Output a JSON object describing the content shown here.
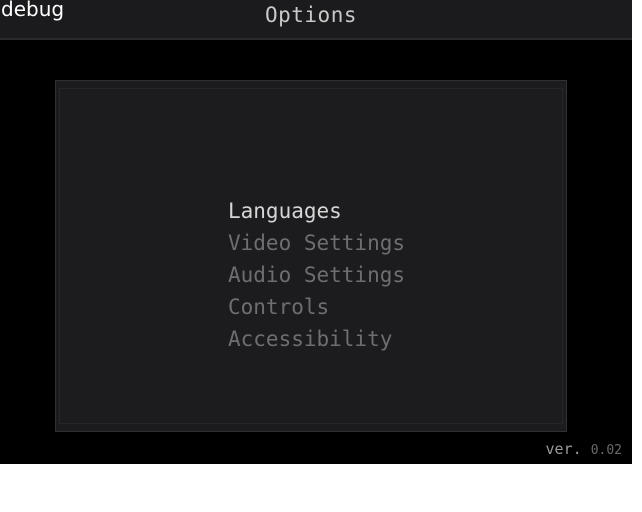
{
  "debug_label": "debug",
  "title": "Options",
  "menu": {
    "selected_index": 0,
    "items": [
      {
        "label": "Languages"
      },
      {
        "label": "Video Settings"
      },
      {
        "label": "Audio Settings"
      },
      {
        "label": "Controls"
      },
      {
        "label": "Accessibility"
      }
    ]
  },
  "version": {
    "prefix": "ver.",
    "number": "0.02"
  },
  "colors": {
    "background": "#000000",
    "panel": "#1c1c1e",
    "selected_text": "#d6d6d6",
    "unselected_text": "#6e6e70"
  }
}
